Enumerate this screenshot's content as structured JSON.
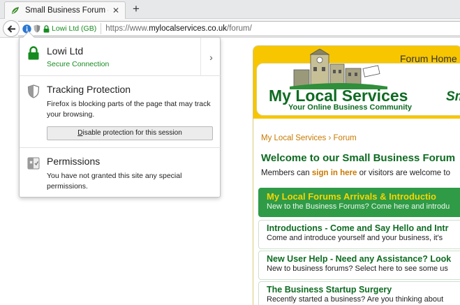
{
  "tab": {
    "title": "Small Business Forum - Fri...",
    "close_glyph": "✕",
    "new_tab_glyph": "+"
  },
  "navbar": {
    "identity_label": "Lowi Ltd (GB)",
    "url_prefix": "https://www.",
    "url_host": "mylocalservices.co.uk",
    "url_path": "/forum/"
  },
  "popup": {
    "identity": {
      "name": "Lowi Ltd",
      "status": "Secure Connection",
      "expand_glyph": "›"
    },
    "tracking": {
      "heading": "Tracking Protection",
      "text": "Firefox is blocking parts of the page that may track your browsing.",
      "button_accel": "D",
      "button_rest": "isable protection for this session"
    },
    "permissions": {
      "heading": "Permissions",
      "text": "You have not granted this site any special permissions."
    }
  },
  "site": {
    "forum_home": "Forum Home",
    "title": "My Local Services",
    "tagline": "Your Online Business Community",
    "side_text": "Sm",
    "breadcrumb": "My Local Services › Forum",
    "welcome": "Welcome to our Small Business Forum",
    "members_pre": "Members can ",
    "members_signin": "sign in here",
    "members_post": " or visitors are welcome to",
    "forums": [
      {
        "title": "My Local Forums Arrivals & Introductio",
        "desc": "New to the Business Forums? Come here and introdu"
      },
      {
        "title": "Introductions - Come and Say Hello and Intr",
        "desc": "Come and introduce yourself and your business, it's"
      },
      {
        "title": "New User Help - Need any Assistance? Look",
        "desc": "New to business forums? Select here to see some us"
      },
      {
        "title": "The Business Startup Surgery",
        "desc": "Recently started a business? Are you thinking about"
      }
    ]
  },
  "colors": {
    "secure_green": "#168b1f",
    "brand_yellow": "#f7c600",
    "brand_green": "#0e6b22",
    "link_orange": "#c87a00"
  }
}
